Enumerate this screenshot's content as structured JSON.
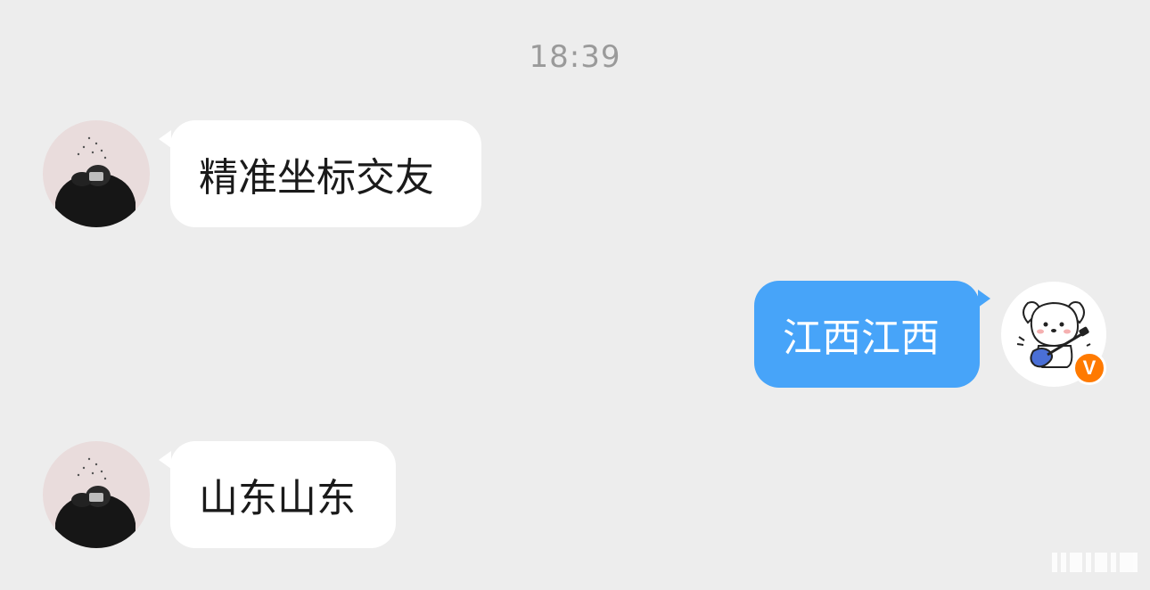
{
  "chat": {
    "timestamp": "18:39",
    "messages": [
      {
        "direction": "incoming",
        "text": "精准坐标交友"
      },
      {
        "direction": "outgoing",
        "text": "江西江西"
      },
      {
        "direction": "incoming",
        "text": "山东山东"
      }
    ],
    "self_badge": "V"
  },
  "colors": {
    "background": "#ededed",
    "incoming_bubble": "#ffffff",
    "outgoing_bubble": "#47a4f9",
    "badge": "#ff7a00",
    "timestamp_text": "#9a9a9a"
  },
  "icons": {
    "contact_avatar": "person-photo-avatar",
    "self_avatar": "puppy-guitar-avatar",
    "verified_badge": "vip-v-badge-icon",
    "watermark": "watermark-stripes"
  }
}
